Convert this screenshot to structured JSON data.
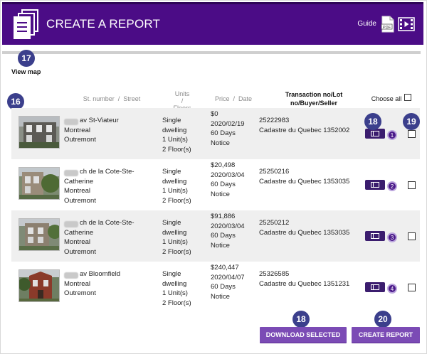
{
  "header": {
    "title": "CREATE A REPORT",
    "guide_label": "Guide",
    "pdf_icon": "pdf-file-icon",
    "video_icon": "video-icon",
    "logo_icon": "documents-stack-icon"
  },
  "callouts": {
    "view_map": "17",
    "list": "16",
    "row_button": "18",
    "checkbox": "19",
    "download": "18",
    "create": "20"
  },
  "view_map_label": "View map",
  "columns": {
    "street": "St. number  /  Street",
    "units": "Units\n/\nFloors",
    "price": "Price  /  Date",
    "transaction": "Transaction no/Lot\nno/Buyer/Seller",
    "choose_all": "Choose all"
  },
  "rows": [
    {
      "street_number": "1234",
      "street": "av St-Viateur",
      "city": "Montreal",
      "borough": "Outremont",
      "type": "Single dwelling",
      "units": "1 Unit(s)",
      "floors": "2 Floor(s)",
      "price": "$0",
      "date": "2020/02/19",
      "notice": "60 Days Notice",
      "transaction_no": "25222983",
      "cadastre": "Cadastre du Quebec 1352002",
      "number": "1",
      "checked": false
    },
    {
      "street_number": "748",
      "street": "ch de la Cote-Ste-Catherine",
      "city": "Montreal",
      "borough": "Outremont",
      "type": "Single dwelling",
      "units": "1 Unit(s)",
      "floors": "2 Floor(s)",
      "price": "$20,498",
      "date": "2020/03/04",
      "notice": "60 Days Notice",
      "transaction_no": "25250216",
      "cadastre": "Cadastre du Quebec 1353035",
      "number": "2",
      "checked": false
    },
    {
      "street_number": "748",
      "street": "ch de la Cote-Ste-Catherine",
      "city": "Montreal",
      "borough": "Outremont",
      "type": "Single dwelling",
      "units": "1 Unit(s)",
      "floors": "2 Floor(s)",
      "price": "$91,886",
      "date": "2020/03/04",
      "notice": "60 Days Notice",
      "transaction_no": "25250212",
      "cadastre": "Cadastre du Quebec 1353035",
      "number": "3",
      "checked": false
    },
    {
      "street_number": "249",
      "street": "av Bloomfield",
      "city": "Montreal",
      "borough": "Outremont",
      "type": "Single dwelling",
      "units": "1 Unit(s)",
      "floors": "2 Floor(s)",
      "price": "$240,447",
      "date": "2020/04/07",
      "notice": "60 Days Notice",
      "transaction_no": "25326585",
      "cadastre": "Cadastre du Quebec 1351231",
      "number": "4",
      "checked": false
    }
  ],
  "buttons": {
    "download_selected": "DOWNLOAD SELECTED",
    "create_report": "CREATE REPORT"
  },
  "colors": {
    "header_bg": "#4b0c86",
    "button_bg": "#7b4bb5",
    "badge_bg": "#3b3f8c"
  }
}
